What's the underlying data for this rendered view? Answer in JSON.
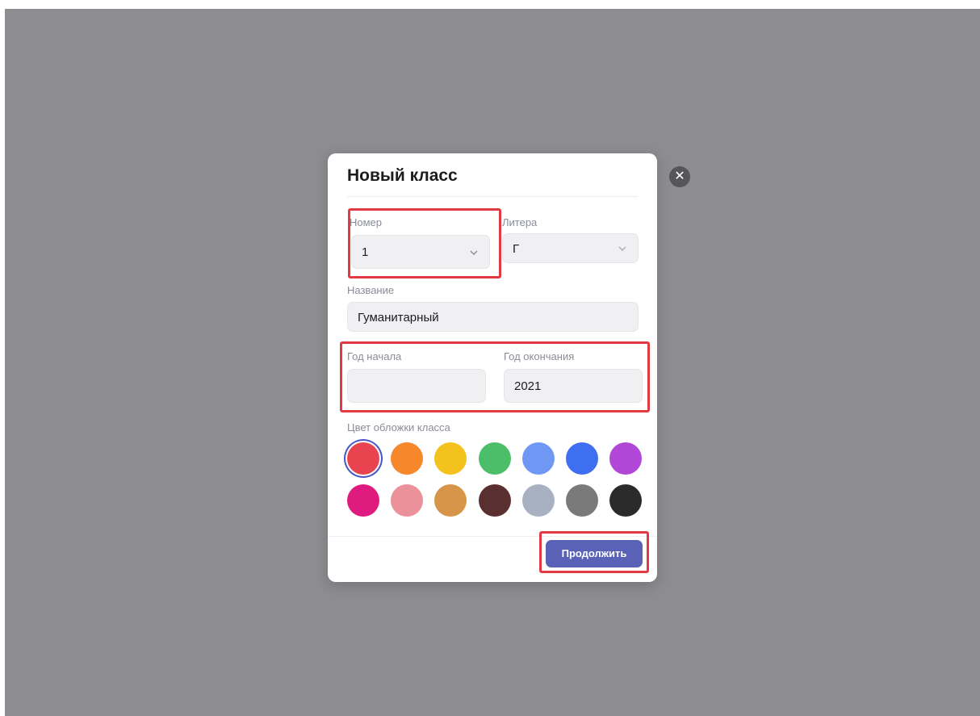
{
  "dialog": {
    "title": "Новый класс",
    "close_icon": "close-icon",
    "number": {
      "label": "Номер",
      "value": "1"
    },
    "litera": {
      "label": "Литера",
      "value": "Г"
    },
    "name": {
      "label": "Название",
      "value": "Гуманитарный"
    },
    "start_year": {
      "label": "Год начала",
      "value": ""
    },
    "end_year": {
      "label": "Год окончания",
      "value": "2021"
    },
    "cover_color": {
      "label": "Цвет обложки класса",
      "selected_index": 0,
      "colors": [
        "#e9434f",
        "#f6872b",
        "#f4c21c",
        "#4cbd69",
        "#6f98f5",
        "#3d6ff0",
        "#b147d6",
        "#e01b80",
        "#ea919a",
        "#d69548",
        "#5a2f2f",
        "#a7b1c2",
        "#7a7a7a",
        "#2b2b2b"
      ]
    },
    "continue_label": "Продолжить",
    "accent_color": "#5a62b8",
    "highlight_color": "#e23a43"
  }
}
